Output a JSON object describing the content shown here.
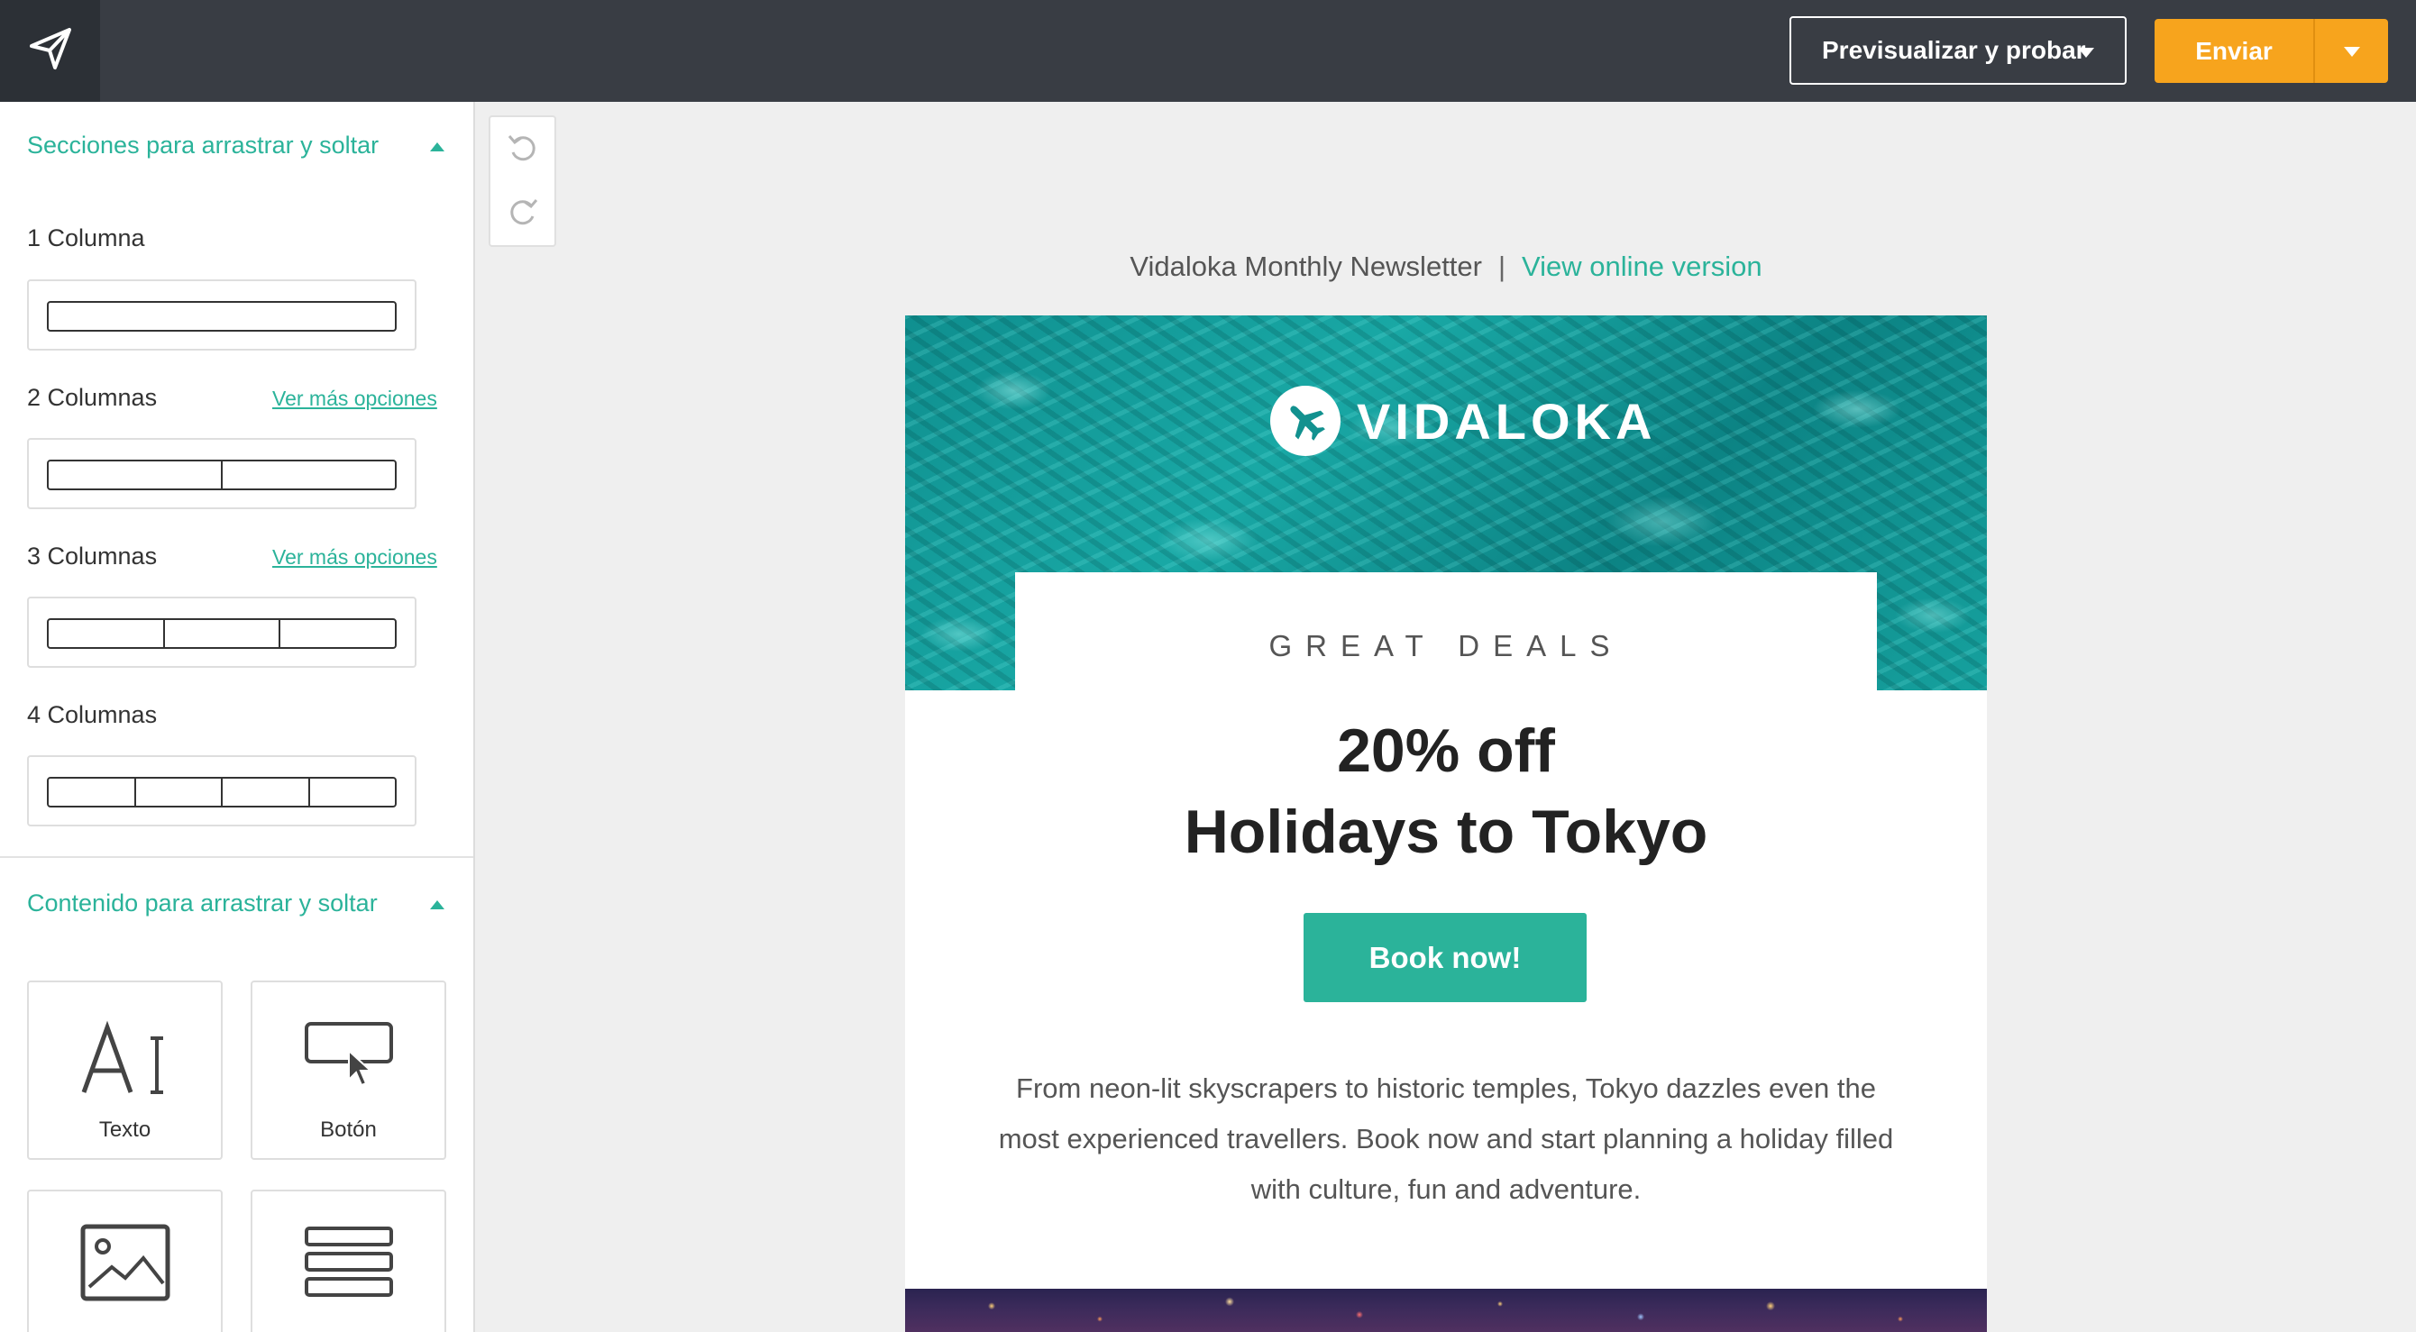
{
  "topbar": {
    "logo_icon": "paper-plane-icon",
    "preview_label": "Previsualizar y probar",
    "send_label": "Enviar",
    "accent_color": "#f7a41d"
  },
  "sidebar": {
    "sections_title": "Secciones para arrastrar y soltar",
    "columns": [
      {
        "label": "1 Columna",
        "count": 1,
        "more": ""
      },
      {
        "label": "2 Columnas",
        "count": 2,
        "more": "Ver más opciones"
      },
      {
        "label": "3 Columnas",
        "count": 3,
        "more": "Ver más opciones"
      },
      {
        "label": "4 Columnas",
        "count": 4,
        "more": ""
      }
    ],
    "content_title": "Contenido para arrastrar y soltar",
    "content_items": [
      {
        "label": "Texto",
        "icon": "text-icon"
      },
      {
        "label": "Botón",
        "icon": "button-icon"
      },
      {
        "label": "",
        "icon": "image-icon"
      },
      {
        "label": "",
        "icon": "divider-icon"
      }
    ],
    "accent_color": "#2bb39a"
  },
  "editor": {
    "undo_icon": "undo-icon",
    "redo_icon": "redo-icon"
  },
  "email": {
    "newsletter_name": "Vidaloka Monthly Newsletter",
    "separator": "|",
    "online_link": "View online version",
    "brand_name": "VIDALOKA",
    "brand_icon": "airplane-icon",
    "eyebrow": "GREAT DEALS",
    "headline_line1": "20% off",
    "headline_line2": "Holidays to Tokyo",
    "cta_label": "Book now!",
    "body_text": "From neon-lit skyscrapers to historic temples, Tokyo dazzles even the most experienced travellers. Book now and start planning a holiday filled with culture, fun and adventure.",
    "cta_color": "#2bb39a"
  }
}
